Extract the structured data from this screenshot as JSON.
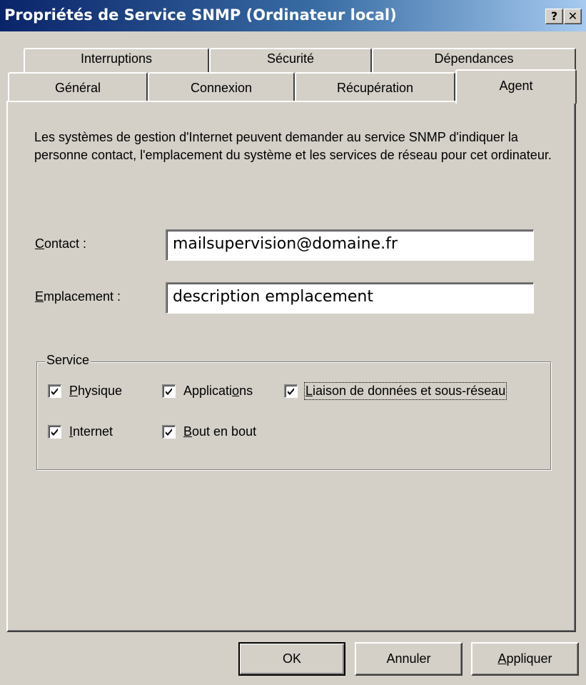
{
  "window": {
    "title": "Propriétés de Service SNMP (Ordinateur local)",
    "help_button": "?",
    "close_button": "✕"
  },
  "tabs": {
    "row1": [
      "Interruptions",
      "Sécurité",
      "Dépendances"
    ],
    "row2": [
      "Général",
      "Connexion",
      "Récupération",
      "Agent"
    ],
    "active": "Agent"
  },
  "agent": {
    "description": "Les systèmes de gestion d'Internet peuvent demander au service SNMP d'indiquer la personne contact, l'emplacement du système et les services de réseau pour cet ordinateur.",
    "contact": {
      "label_key": "C",
      "label_rest": "ontact :",
      "value": "mailsupervision@domaine.fr"
    },
    "location": {
      "label_key": "E",
      "label_rest": "mplacement :",
      "value": "description emplacement"
    },
    "service_group": {
      "title": "Service",
      "physique": {
        "key": "P",
        "rest": "hysique",
        "checked": true
      },
      "applications": {
        "pre": "Applicati",
        "key": "o",
        "post": "ns",
        "checked": true
      },
      "liaison": {
        "key": "L",
        "rest": "iaison de données et sous-réseau",
        "checked": true
      },
      "internet": {
        "key": "I",
        "rest": "nternet",
        "checked": true
      },
      "bout_en_bout": {
        "key": "B",
        "rest": "out en bout",
        "checked": true
      }
    }
  },
  "buttons": {
    "ok": "OK",
    "cancel": "Annuler",
    "apply_key": "A",
    "apply_rest": "ppliquer"
  }
}
